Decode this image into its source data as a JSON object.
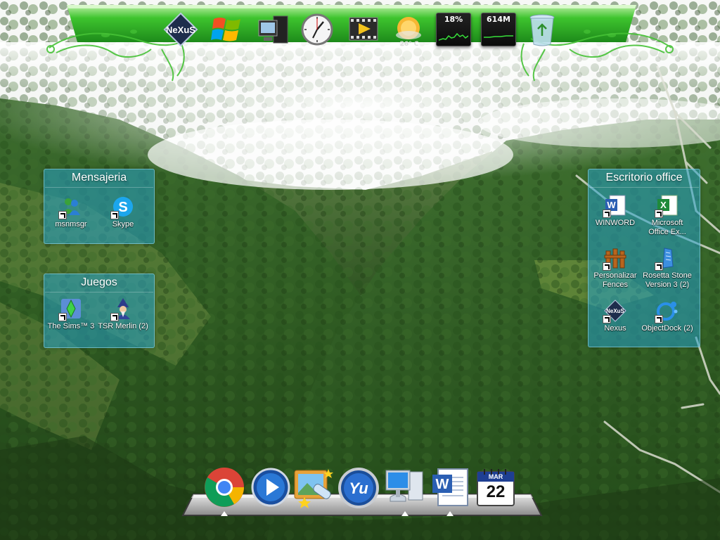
{
  "top_dock": {
    "cpu_usage": "18%",
    "memory_usage": "614M",
    "temperature": "26° C",
    "items": [
      "nexus-logo-icon",
      "windows-start-icon",
      "computer-icon",
      "clock-icon",
      "media-player-icon",
      "weather-icon",
      "cpu-meter",
      "memory-meter",
      "recycle-bin-icon"
    ]
  },
  "fences": {
    "mensajeria": {
      "title": "Mensajeria",
      "icons": [
        {
          "label": "msnmsgr",
          "icon": "msn-messenger-icon"
        },
        {
          "label": "Skype",
          "icon": "skype-icon"
        }
      ]
    },
    "juegos": {
      "title": "Juegos",
      "icons": [
        {
          "label": "The Sims™ 3",
          "icon": "sims3-icon"
        },
        {
          "label": "TSR Merlin (2)",
          "icon": "merlin-icon"
        }
      ]
    },
    "office": {
      "title": "Escritorio office",
      "icons": [
        {
          "label": "WINWORD",
          "icon": "word-icon"
        },
        {
          "label": "Microsoft Office Ex...",
          "icon": "excel-icon"
        },
        {
          "label": "Personalizar Fences",
          "icon": "fences-icon"
        },
        {
          "label": "Rosetta Stone Version 3 (2)",
          "icon": "rosetta-stone-icon"
        },
        {
          "label": "Nexus",
          "icon": "nexus-icon"
        },
        {
          "label": "ObjectDock (2)",
          "icon": "objectdock-icon"
        }
      ]
    }
  },
  "bottom_dock": {
    "calendar_month": "MAR",
    "calendar_day": "22",
    "items": [
      "chrome-icon",
      "media-player-icon",
      "photo-viewer-icon",
      "yu-icon",
      "my-computer-icon",
      "word-icon",
      "calendar-icon"
    ]
  },
  "colors": {
    "fence_bg": "#26a0c8",
    "nexus_green": "#3bbf2a"
  }
}
